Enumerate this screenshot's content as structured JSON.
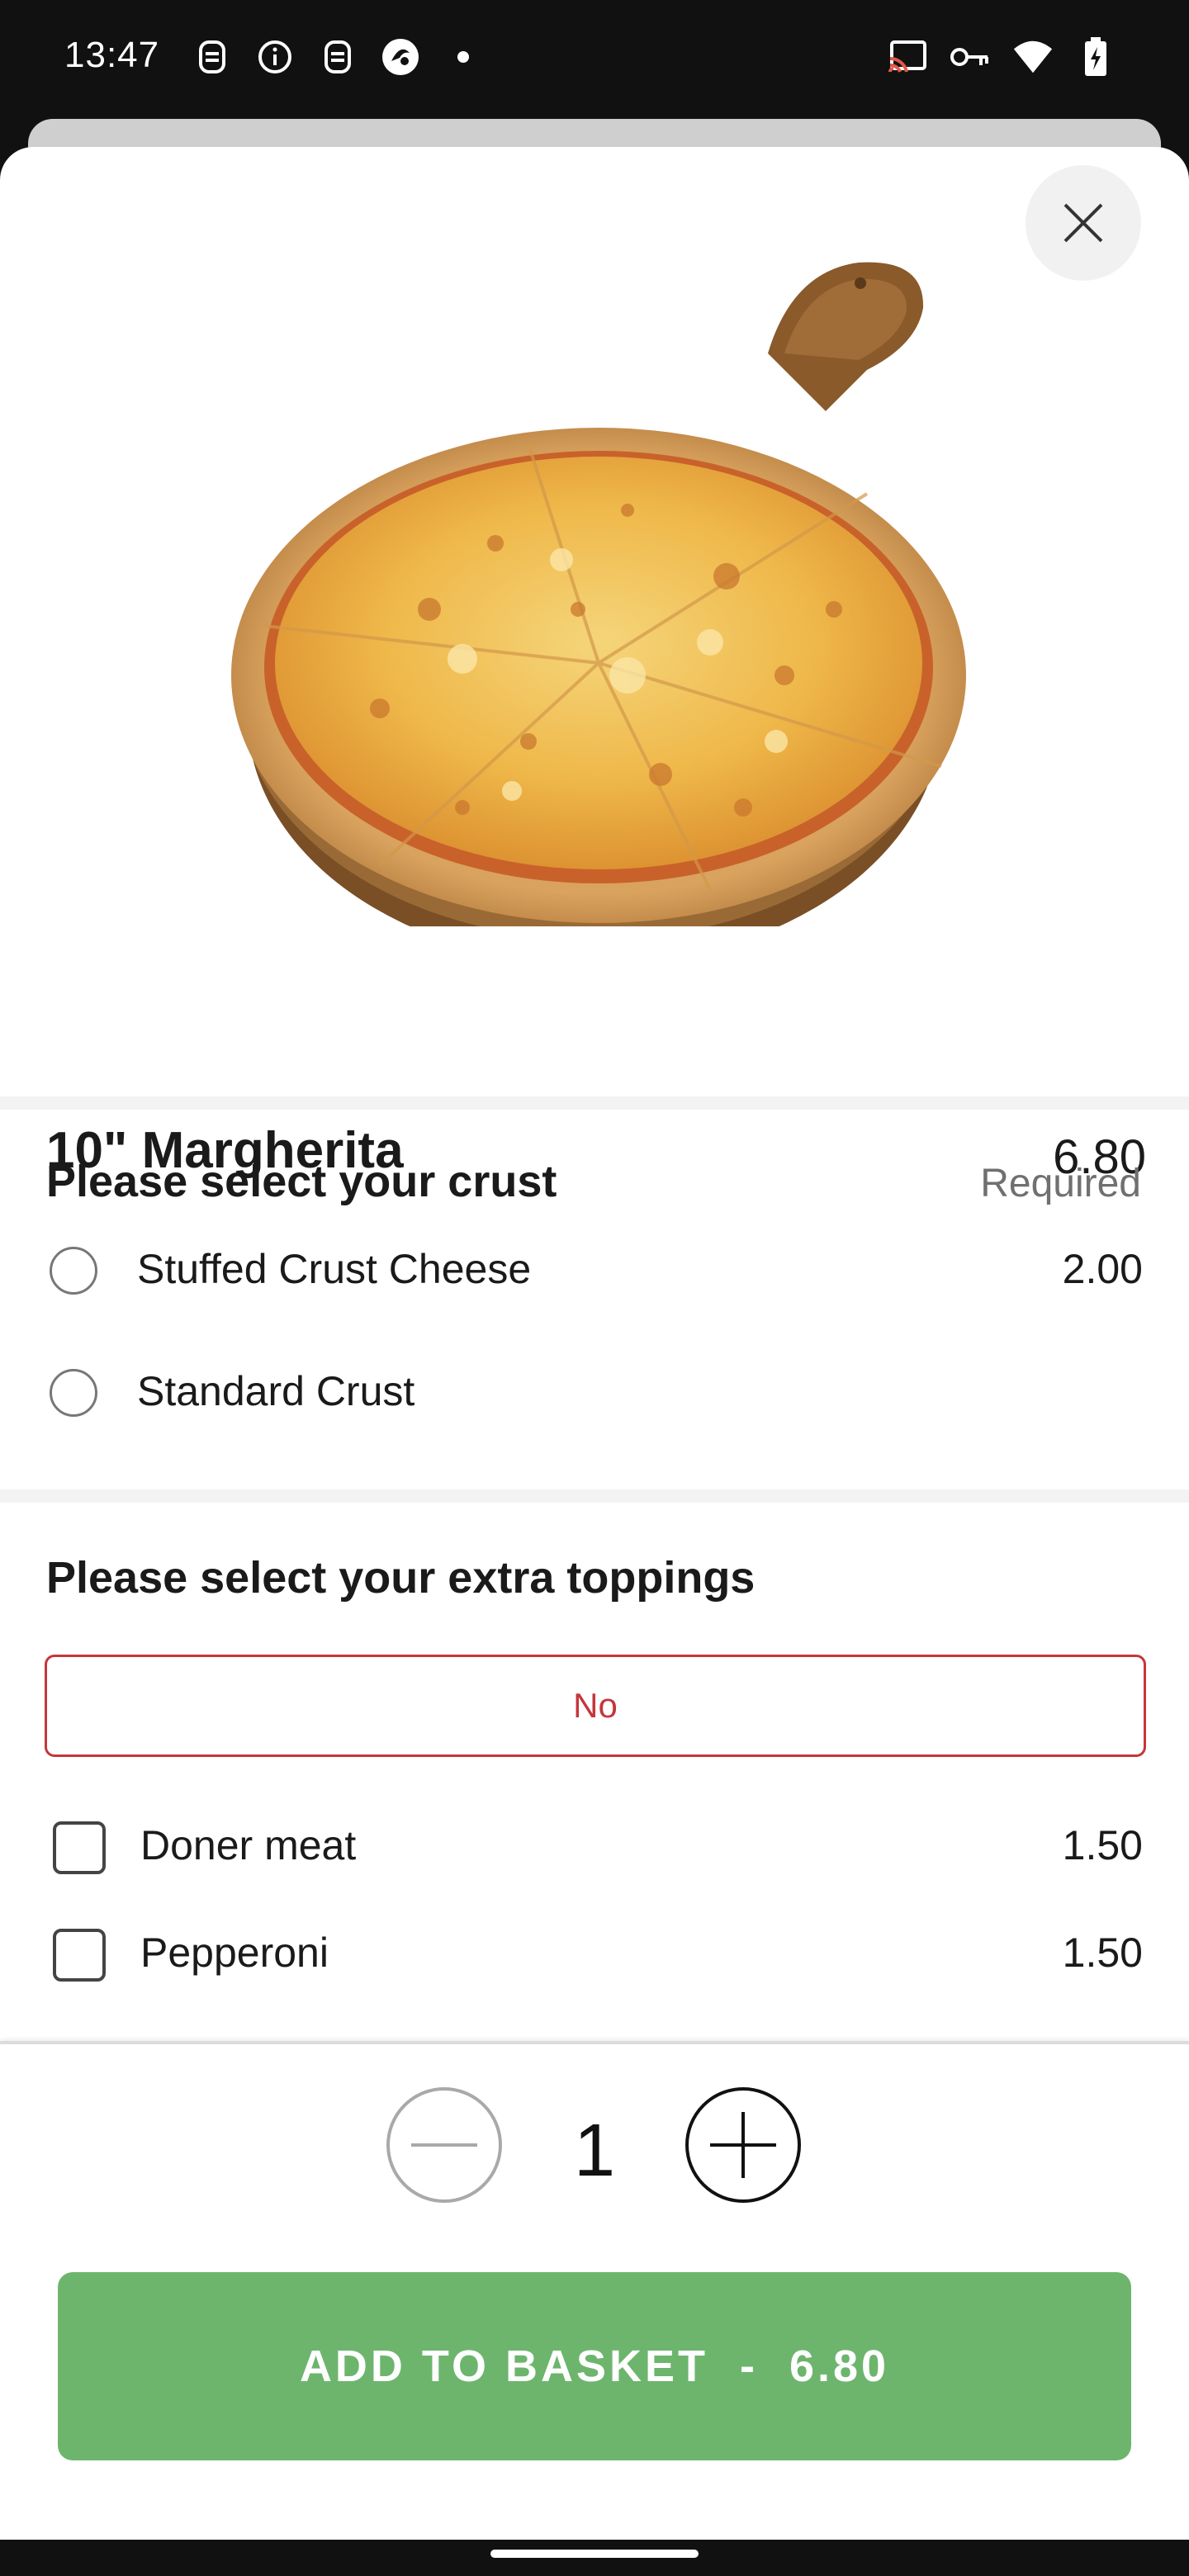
{
  "status_bar": {
    "time": "13:47",
    "left_icons": [
      "notification-icon",
      "info-icon",
      "notification-icon",
      "app-icon",
      "dot-icon"
    ],
    "right_icons": [
      "cast-icon",
      "vpn-key-icon",
      "wifi-icon",
      "battery-charging-icon"
    ]
  },
  "product": {
    "name": "10\" Margherita",
    "price": "6.80",
    "image": "margherita-pizza-image"
  },
  "crust_section": {
    "title": "Please select your crust",
    "required_label": "Required",
    "options": [
      {
        "label": "Stuffed Crust Cheese",
        "price": "2.00",
        "selected": false
      },
      {
        "label": "Standard Crust",
        "price": "",
        "selected": false
      }
    ]
  },
  "toppings_section": {
    "title": "Please select your extra toppings",
    "no_button_label": "No",
    "options": [
      {
        "label": "Doner meat",
        "price": "1.50",
        "checked": false
      },
      {
        "label": "Pepperoni",
        "price": "1.50",
        "checked": false
      }
    ]
  },
  "quantity": {
    "value": "1"
  },
  "add_button": {
    "label": "ADD TO BASKET  -  6.80"
  },
  "colors": {
    "accent_green": "#6db56d",
    "no_button_red": "#c5363a"
  }
}
